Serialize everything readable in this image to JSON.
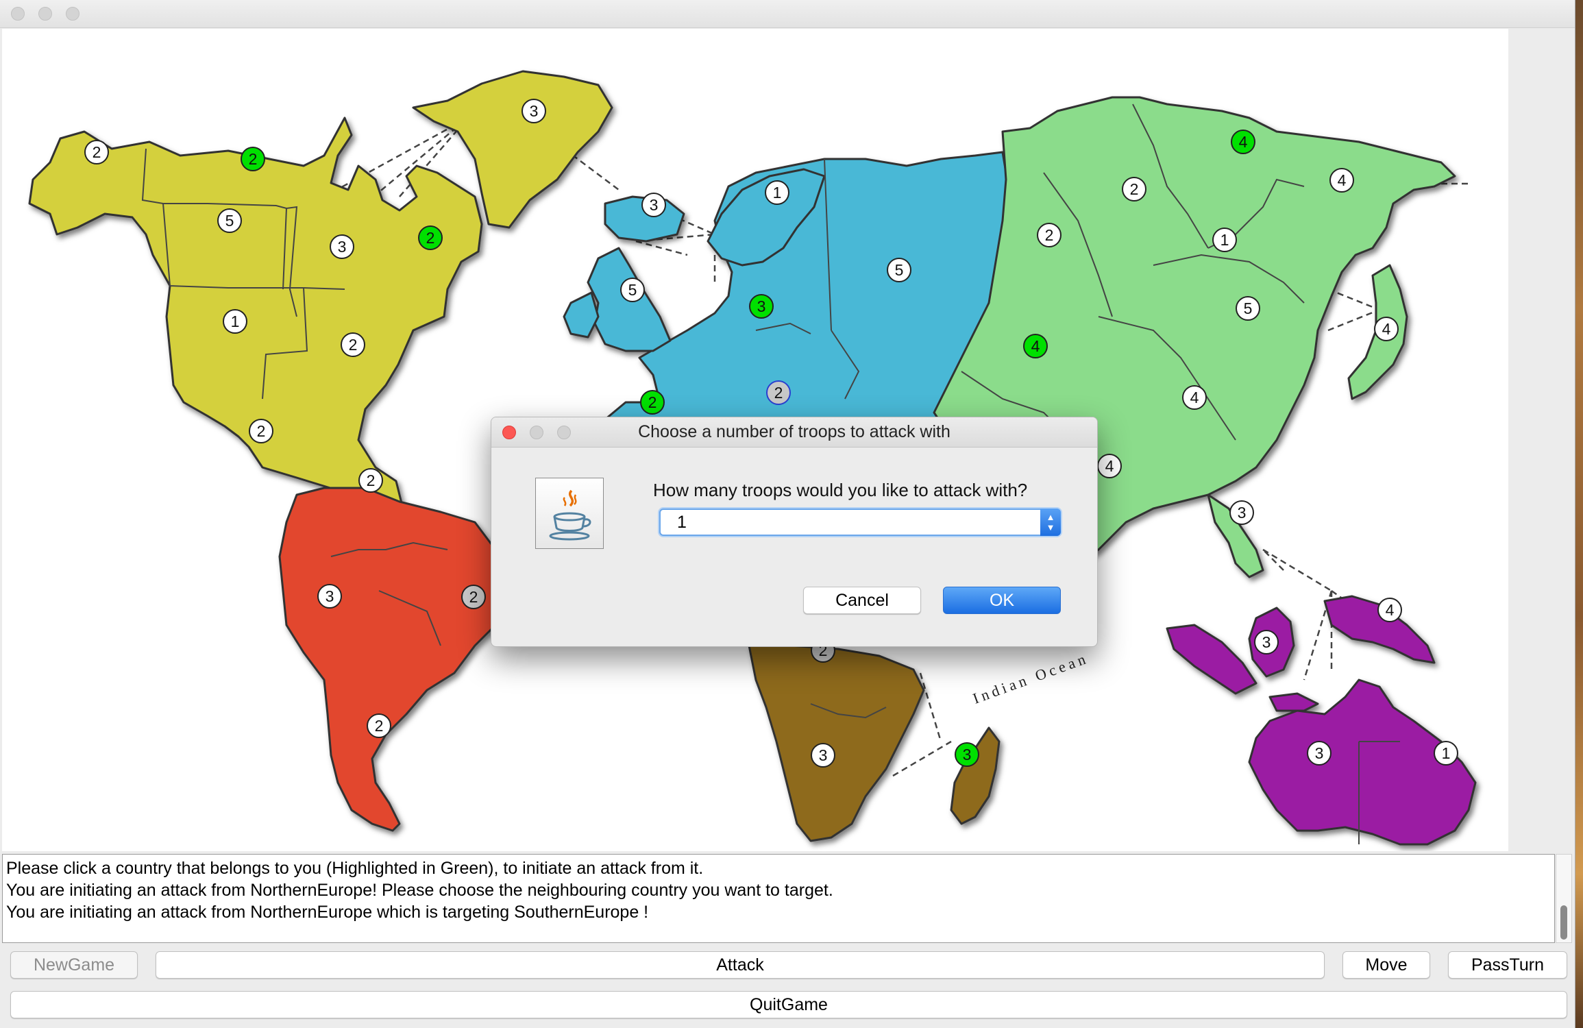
{
  "window": {
    "title": ""
  },
  "map": {
    "colors": {
      "north_america": "#d4d03c",
      "south_america": "#e2472d",
      "europe": "#4ab8d6",
      "africa": "#8e6a1c",
      "asia": "#8bdc8b",
      "australia": "#9b1fa3",
      "highlight_green": "#00e000",
      "selected_gray": "#c8c8c8"
    },
    "ocean_label": "Indian Ocean",
    "territories": [
      {
        "name": "Alaska",
        "troops": "2",
        "state": "normal"
      },
      {
        "name": "Northwest Territory",
        "troops": "2",
        "state": "owned"
      },
      {
        "name": "Greenland",
        "troops": "3",
        "state": "normal"
      },
      {
        "name": "Alberta",
        "troops": "5",
        "state": "normal"
      },
      {
        "name": "Ontario",
        "troops": "3",
        "state": "normal"
      },
      {
        "name": "Quebec",
        "troops": "2",
        "state": "owned"
      },
      {
        "name": "Western United States",
        "troops": "1",
        "state": "normal"
      },
      {
        "name": "Eastern United States",
        "troops": "2",
        "state": "normal"
      },
      {
        "name": "Central America",
        "troops": "2",
        "state": "normal"
      },
      {
        "name": "Venezuela",
        "troops": "2",
        "state": "normal"
      },
      {
        "name": "Peru",
        "troops": "3",
        "state": "normal"
      },
      {
        "name": "Brazil",
        "troops": "2",
        "state": "target"
      },
      {
        "name": "Argentina",
        "troops": "2",
        "state": "normal"
      },
      {
        "name": "Iceland",
        "troops": "3",
        "state": "normal"
      },
      {
        "name": "Scandinavia",
        "troops": "1",
        "state": "normal"
      },
      {
        "name": "Great Britain",
        "troops": "5",
        "state": "normal"
      },
      {
        "name": "Northern Europe",
        "troops": "3",
        "state": "owned"
      },
      {
        "name": "Ukraine",
        "troops": "5",
        "state": "normal"
      },
      {
        "name": "Western Europe",
        "troops": "2",
        "state": "owned"
      },
      {
        "name": "Southern Europe",
        "troops": "2",
        "state": "selected"
      },
      {
        "name": "Ural",
        "troops": "2",
        "state": "normal"
      },
      {
        "name": "Siberia",
        "troops": "2",
        "state": "normal"
      },
      {
        "name": "Yakutsk",
        "troops": "4",
        "state": "owned"
      },
      {
        "name": "Kamchatka",
        "troops": "4",
        "state": "normal"
      },
      {
        "name": "Irkutsk",
        "troops": "1",
        "state": "normal"
      },
      {
        "name": "Mongolia",
        "troops": "5",
        "state": "normal"
      },
      {
        "name": "Japan",
        "troops": "4",
        "state": "normal"
      },
      {
        "name": "Afghanistan",
        "troops": "4",
        "state": "owned"
      },
      {
        "name": "China",
        "troops": "4",
        "state": "normal"
      },
      {
        "name": "Middle East",
        "troops": "4",
        "state": "normal"
      },
      {
        "name": "Siam",
        "troops": "3",
        "state": "normal"
      },
      {
        "name": "Indonesia",
        "troops": "3",
        "state": "normal"
      },
      {
        "name": "New Guinea",
        "troops": "4",
        "state": "normal"
      },
      {
        "name": "Western Australia",
        "troops": "3",
        "state": "normal"
      },
      {
        "name": "Eastern Australia",
        "troops": "1",
        "state": "normal"
      },
      {
        "name": "East Africa",
        "troops": "2",
        "state": "target"
      },
      {
        "name": "South Africa",
        "troops": "3",
        "state": "normal"
      },
      {
        "name": "Madagascar",
        "troops": "3",
        "state": "owned"
      }
    ]
  },
  "log": {
    "lines": [
      "Please click a country that belongs to you (Highlighted in Green), to initiate an attack from it.",
      "You are initiating an attack from NorthernEurope! Please choose the neighbouring country you want to target.",
      "You are initiating an attack from NorthernEurope which is targeting SouthernEurope !"
    ]
  },
  "buttons": {
    "new_game": "NewGame",
    "attack": "Attack",
    "move": "Move",
    "pass_turn": "PassTurn",
    "quit_game": "QuitGame"
  },
  "dialog": {
    "title": "Choose a number of troops to attack with",
    "icon": "java-coffee-cup-icon",
    "prompt": "How many troops would you like to attack with?",
    "selected_value": "1",
    "cancel_label": "Cancel",
    "ok_label": "OK",
    "ok_color": "#1f6fe0"
  }
}
